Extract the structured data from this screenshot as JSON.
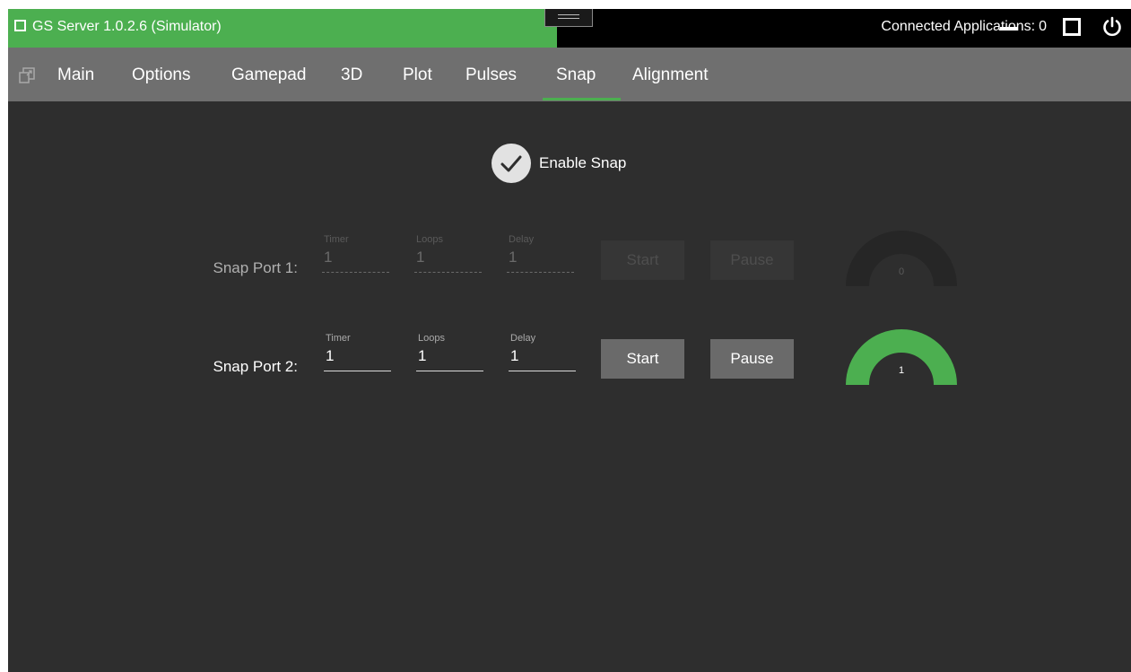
{
  "window": {
    "title": "GS Server 1.0.2.6 (Simulator)",
    "connected_label": "Connected Applications:",
    "connected_count": "0",
    "accent_color": "#4caf50"
  },
  "icons": {
    "app": "window-square-icon",
    "drag": "drag-handle-icon",
    "minimize": "minimize-icon",
    "maximize": "maximize-icon",
    "power": "power-icon",
    "popout": "popout-window-icon",
    "check": "checkmark-icon"
  },
  "nav": {
    "tabs": [
      {
        "label": "Main",
        "active": false
      },
      {
        "label": "Options",
        "active": false
      },
      {
        "label": "Gamepad",
        "active": false
      },
      {
        "label": "3D",
        "active": false
      },
      {
        "label": "Plot",
        "active": false
      },
      {
        "label": "Pulses",
        "active": false
      },
      {
        "label": "Snap",
        "active": true
      },
      {
        "label": "Alignment",
        "active": false
      }
    ]
  },
  "snap": {
    "enable_label": "Enable Snap",
    "enabled": true,
    "ports": [
      {
        "label": "Snap Port 1:",
        "enabled": false,
        "timer_label": "Timer",
        "timer": "1",
        "loops_label": "Loops",
        "loops": "1",
        "delay_label": "Delay",
        "delay": "1",
        "start_label": "Start",
        "pause_label": "Pause",
        "gauge_value": "0",
        "gauge_fraction": 0
      },
      {
        "label": "Snap Port 2:",
        "enabled": true,
        "timer_label": "Timer",
        "timer": "1",
        "loops_label": "Loops",
        "loops": "1",
        "delay_label": "Delay",
        "delay": "1",
        "start_label": "Start",
        "pause_label": "Pause",
        "gauge_value": "1",
        "gauge_fraction": 1
      }
    ]
  }
}
